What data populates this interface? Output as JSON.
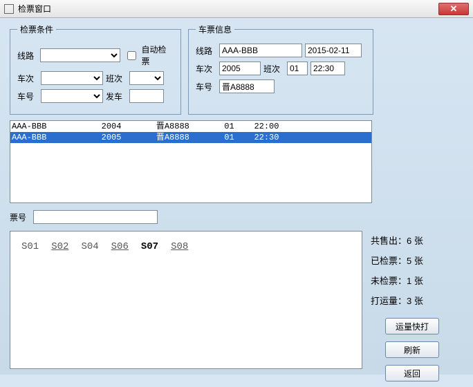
{
  "window": {
    "title": "检票窗口"
  },
  "cond": {
    "legend": "检票条件",
    "route_label": "线路",
    "route_value": "",
    "auto_label": "自动检票",
    "auto_checked": false,
    "trip_label": "车次",
    "trip_value": "",
    "shift_label": "班次",
    "shift_value": "",
    "bus_label": "车号",
    "bus_value": "",
    "depart_label": "发车",
    "depart_value": ""
  },
  "info": {
    "legend": "车票信息",
    "route_label": "线路",
    "route_value": "AAA-BBB",
    "date_value": "2015-02-11",
    "trip_label": "车次",
    "trip_value": "2005",
    "shift_label": "班次",
    "shift_value": "01",
    "time_value": "22:30",
    "bus_label": "车号",
    "bus_value": "晋A8888"
  },
  "list": [
    {
      "route": "AAA-BBB",
      "trip": "2004",
      "bus": "晋A8888",
      "shift": "01",
      "time": "22:00",
      "selected": false
    },
    {
      "route": "AAA-BBB",
      "trip": "2005",
      "bus": "晋A8888",
      "shift": "01",
      "time": "22:30",
      "selected": true
    }
  ],
  "ticketno": {
    "label": "票号",
    "value": ""
  },
  "seats": [
    {
      "code": "S01",
      "style": "plain"
    },
    {
      "code": "S02",
      "style": "u"
    },
    {
      "code": "S04",
      "style": "plain"
    },
    {
      "code": "S06",
      "style": "u"
    },
    {
      "code": "S07",
      "style": "bold"
    },
    {
      "code": "S08",
      "style": "u"
    }
  ],
  "stats": {
    "sold": "共售出：6 张",
    "checked": "已检票：5 张",
    "unchecked": "未检票：1 张",
    "carry": "打运量：3 张"
  },
  "buttons": {
    "quick": "运量快打",
    "refresh": "刷新",
    "back": "返回"
  }
}
